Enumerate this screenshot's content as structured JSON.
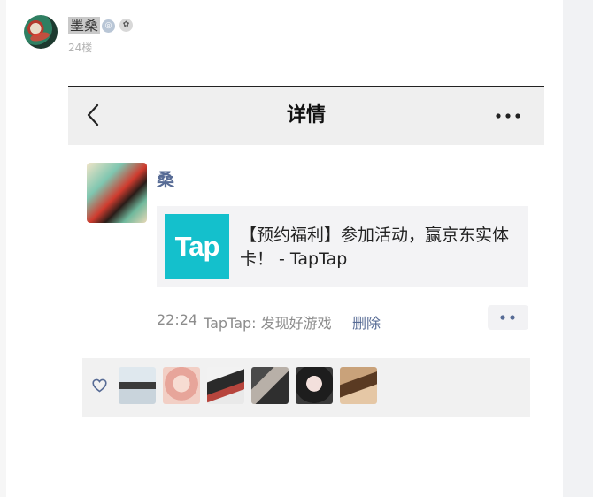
{
  "post": {
    "username": "墨桑",
    "floor": "24楼"
  },
  "moment": {
    "nav_title": "详情",
    "author": "桑",
    "link": {
      "logo_text": "Tap",
      "title": "【预约福利】参加活动，赢京东实体卡！ - TapTap"
    },
    "time": "22:24",
    "source": "TapTap: 发现好游戏",
    "delete_label": "删除",
    "likers_count": 6
  },
  "colors": {
    "link_blue": "#576b95",
    "taptap_teal": "#14c0cc"
  },
  "icons": {
    "back": "chevron-left-icon",
    "more": "more-dots-icon",
    "action": "two-dots-icon",
    "like": "heart-outline-icon"
  }
}
